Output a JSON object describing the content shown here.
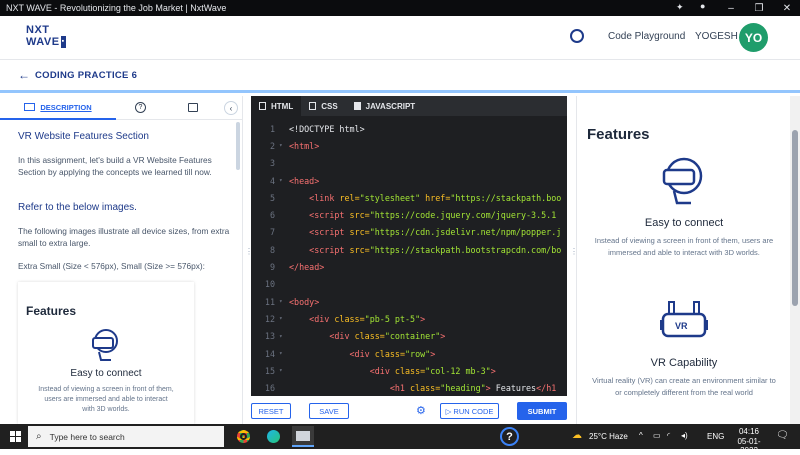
{
  "window": {
    "title": "NXT WAVE - Revolutionizing the Job Market | NxtWave"
  },
  "header": {
    "logo_line1": "NXT",
    "logo_line2": "WAVE",
    "link": "Code Playground",
    "username": "YOGESH",
    "avatar_initials": "YO"
  },
  "practice": {
    "title": "CODING PRACTICE 6"
  },
  "left_tabs": {
    "description": "DESCRIPTION"
  },
  "description": {
    "heading": "VR Website Features Section",
    "para1": "In this assignment, let's build a VR Website Features Section by applying the concepts we learned till now.",
    "refer": "Refer to the below images.",
    "para2": "The following images illustrate all device sizes, from extra small to extra large.",
    "sizes": "Extra Small (Size < 576px), Small (Size >= 576px):"
  },
  "sample_card": {
    "title": "Features",
    "feature_title": "Easy to connect",
    "feature_text": "Instead of viewing a screen in front of them, users are immersed and able to interact with 3D worlds."
  },
  "editor": {
    "tabs": [
      "HTML",
      "CSS",
      "JAVASCRIPT"
    ],
    "lines": [
      {
        "n": "1",
        "fold": "",
        "text": [
          [
            "pl",
            "<!DOCTYPE html>"
          ]
        ]
      },
      {
        "n": "2",
        "fold": "▾",
        "text": [
          [
            "tg",
            "<html>"
          ]
        ]
      },
      {
        "n": "3",
        "fold": "",
        "text": []
      },
      {
        "n": "4",
        "fold": "▾",
        "text": [
          [
            "tg",
            "<head>"
          ]
        ]
      },
      {
        "n": "5",
        "fold": "",
        "text": [
          [
            "pl",
            "    "
          ],
          [
            "tg",
            "<link "
          ],
          [
            "at",
            "rel="
          ],
          [
            "st",
            "\"stylesheet\" "
          ],
          [
            "at",
            "href="
          ],
          [
            "st",
            "\"https://stackpath.boo"
          ]
        ]
      },
      {
        "n": "6",
        "fold": "",
        "text": [
          [
            "pl",
            "    "
          ],
          [
            "tg",
            "<script "
          ],
          [
            "at",
            "src="
          ],
          [
            "st",
            "\"https://code.jquery.com/jquery-3.5.1"
          ]
        ]
      },
      {
        "n": "7",
        "fold": "",
        "text": [
          [
            "pl",
            "    "
          ],
          [
            "tg",
            "<script "
          ],
          [
            "at",
            "src="
          ],
          [
            "st",
            "\"https://cdn.jsdelivr.net/npm/popper.j"
          ]
        ]
      },
      {
        "n": "8",
        "fold": "",
        "text": [
          [
            "pl",
            "    "
          ],
          [
            "tg",
            "<script "
          ],
          [
            "at",
            "src="
          ],
          [
            "st",
            "\"https://stackpath.bootstrapcdn.com/bo"
          ]
        ]
      },
      {
        "n": "9",
        "fold": "",
        "text": [
          [
            "tg",
            "</head>"
          ]
        ]
      },
      {
        "n": "10",
        "fold": "",
        "text": []
      },
      {
        "n": "11",
        "fold": "▾",
        "text": [
          [
            "tg",
            "<body>"
          ]
        ]
      },
      {
        "n": "12",
        "fold": "▾",
        "text": [
          [
            "pl",
            "    "
          ],
          [
            "tg",
            "<div "
          ],
          [
            "at",
            "class="
          ],
          [
            "st",
            "\"pb-5 pt-5\""
          ],
          [
            "tg",
            ">"
          ]
        ]
      },
      {
        "n": "13",
        "fold": "▾",
        "text": [
          [
            "pl",
            "        "
          ],
          [
            "tg",
            "<div "
          ],
          [
            "at",
            "class="
          ],
          [
            "st",
            "\"container\""
          ],
          [
            "tg",
            ">"
          ]
        ]
      },
      {
        "n": "14",
        "fold": "▾",
        "text": [
          [
            "pl",
            "            "
          ],
          [
            "tg",
            "<div "
          ],
          [
            "at",
            "class="
          ],
          [
            "st",
            "\"row\""
          ],
          [
            "tg",
            ">"
          ]
        ]
      },
      {
        "n": "15",
        "fold": "▾",
        "text": [
          [
            "pl",
            "                "
          ],
          [
            "tg",
            "<div "
          ],
          [
            "at",
            "class="
          ],
          [
            "st",
            "\"col-12 mb-3\""
          ],
          [
            "tg",
            ">"
          ]
        ]
      },
      {
        "n": "16",
        "fold": "",
        "text": [
          [
            "pl",
            "                    "
          ],
          [
            "tg",
            "<h1 "
          ],
          [
            "at",
            "class="
          ],
          [
            "st",
            "\"heading\""
          ],
          [
            "tg",
            "> "
          ],
          [
            "pl",
            "Features"
          ],
          [
            "tg",
            "</h1"
          ]
        ]
      }
    ]
  },
  "buttons": {
    "reset": "RESET",
    "save": "SAVE",
    "run": "▷ RUN CODE",
    "submit": "SUBMIT"
  },
  "preview": {
    "title": "Features",
    "f1_title": "Easy to connect",
    "f1_text": "Instead of viewing a screen in front of them, users are immersed and able to interact with 3D worlds.",
    "f2_title": "VR Capability",
    "f2_text": "Virtual reality (VR) can create an environment similar to or completely different from the real world",
    "vr_badge": "VR"
  },
  "taskbar": {
    "search_placeholder": "Type here to search",
    "weather": "25°C  Haze",
    "lang": "ENG",
    "time": "04:16",
    "date": "05-01-2022"
  },
  "colors": {
    "accent": "#2563eb",
    "brand": "#1e3a8a",
    "avatar": "#1f9d6b",
    "editor_bg": "#1e1f22"
  }
}
